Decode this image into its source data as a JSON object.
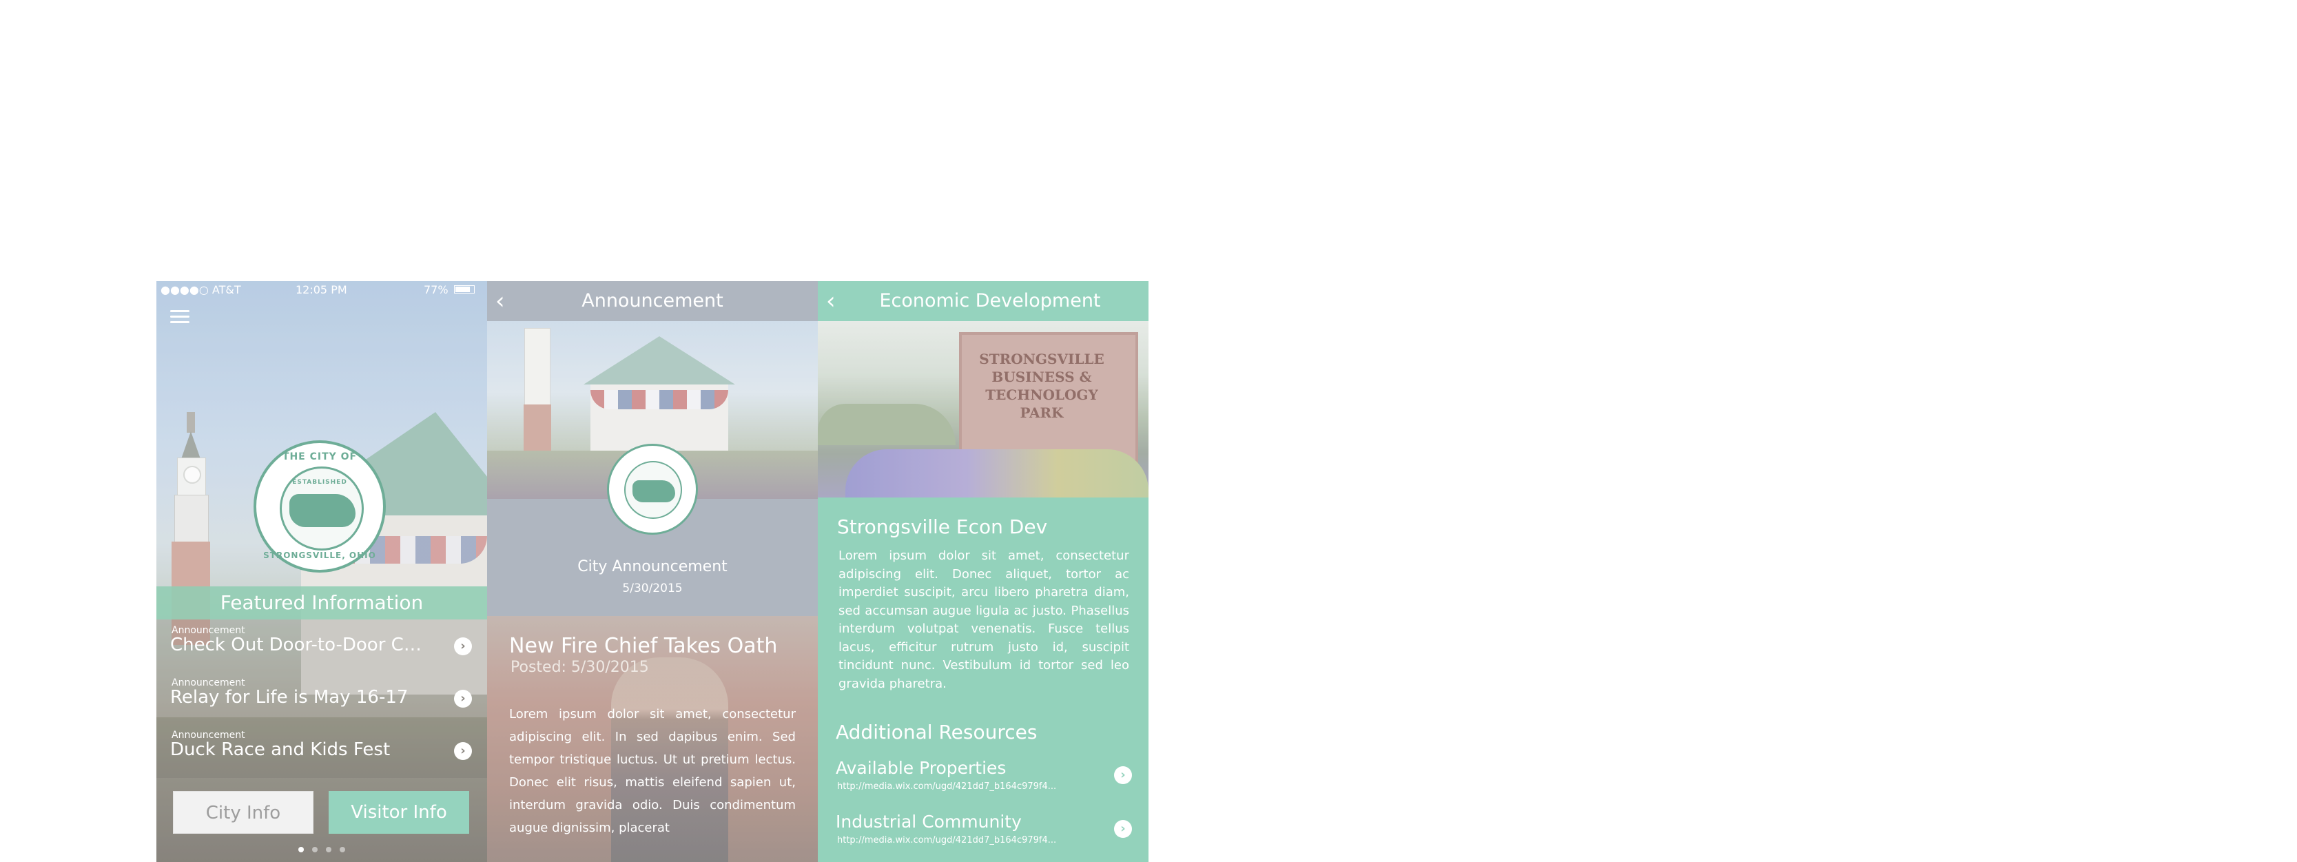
{
  "screen1": {
    "status": {
      "carrier": "●●●●○ AT&T",
      "time": "12:05 PM",
      "battery": "77%"
    },
    "seal": {
      "top": "THE CITY OF",
      "middle": "ESTABLISHED",
      "bottom": "STRONGSVILLE, OHIO"
    },
    "featured_title": "Featured Information",
    "items": [
      {
        "category": "Announcement",
        "title": "Check Out Door-to-Door Con..."
      },
      {
        "category": "Announcement",
        "title": "Relay for Life is May 16-17"
      },
      {
        "category": "Announcement",
        "title": "Duck Race and Kids Fest"
      }
    ],
    "buttons": {
      "city": "City Info",
      "visitor": "Visitor Info"
    },
    "page_dots": 4,
    "active_dot": 0
  },
  "screen2": {
    "header_title": "Announcement",
    "type_label": "City Announcement",
    "date": "5/30/2015",
    "story_title": "New Fire Chief Takes Oath",
    "posted": "Posted: 5/30/2015",
    "body": "Lorem ipsum dolor sit amet, consectetur adipiscing elit. In sed dapibus enim. Sed tempor tristique luctus. Ut ut pretium lectus. Donec elit risus, mattis eleifend sapien ut, interdum gravida odio. Duis condimentum augue dignissim, placerat"
  },
  "screen3": {
    "header_title": "Economic Development",
    "sign_text": "STRONGSVILLE BUSINESS & TECHNOLOGY PARK",
    "title": "Strongsville Econ Dev",
    "body": "Lorem ipsum dolor sit amet, consectetur adipiscing elit. Donec aliquet, tortor ac imperdiet suscipit, arcu libero pharetra diam, sed accumsan augue ligula ac justo. Phasellus interdum volutpat venenatis. Fusce tellus lacus, efficitur rutrum justo id, suscipit tincidunt nunc. Vestibulum id tortor sed leo gravida pharetra.",
    "resources_title": "Additional Resources",
    "resources": [
      {
        "name": "Available Properties",
        "url": "http://media.wix.com/ugd/421dd7_b164c979f4..."
      },
      {
        "name": "Industrial Community",
        "url": "http://media.wix.com/ugd/421dd7_b164c979f4..."
      }
    ]
  },
  "colors": {
    "accent": "#7ecab0",
    "gray_header": "#9ea7b2",
    "seal_green": "#4f9b80"
  }
}
